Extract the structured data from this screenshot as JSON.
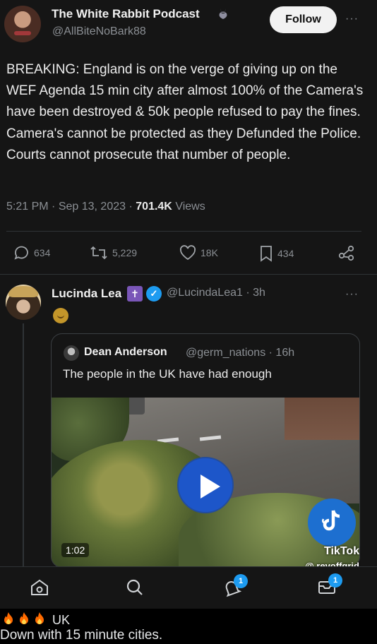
{
  "tweet": {
    "author_name": "The White Rabbit Podcast",
    "author_handle": "@AllBiteNoBark88",
    "follow_label": "Follow",
    "text": "BREAKING: England is on the verge of giving up on the WEF Agenda 15 min city after almost 100% of the Camera's have been destroyed & 50k people refused to pay the fines. Camera's cannot be protected as they Defunded the Police. Courts cannot prosecute that number of people.",
    "time": "5:21 PM",
    "date": "Sep 13, 2023",
    "views_count": "701.4K",
    "views_label": "Views",
    "sep": "·",
    "more_label": "···",
    "actions": {
      "replies": "634",
      "reposts": "5,229",
      "likes": "18K",
      "bookmarks": "434"
    }
  },
  "reply": {
    "author_name": "Lucinda Lea",
    "author_handle": "@LucindaLea1",
    "time_ago": "3h",
    "more_label": "···",
    "quote": {
      "author_name": "Dean Anderson",
      "author_handle": "@germ_nations",
      "time_ago": "16h",
      "text": "The people in the UK have had enough",
      "video_duration": "1:02"
    }
  },
  "overlay": {
    "tiktok_label": "TikTok",
    "tiktok_handle": "@ revoffgrid"
  },
  "bottom_nav": {
    "notifications_badge": "1",
    "messages_badge": "1"
  },
  "caption": {
    "line1": "UK",
    "line2": "Down with 15 minute cities."
  },
  "colors": {
    "background": "#151515",
    "accent": "#1d9bf0",
    "play_button": "#1d56c9",
    "muted_text": "#8b8f94"
  }
}
